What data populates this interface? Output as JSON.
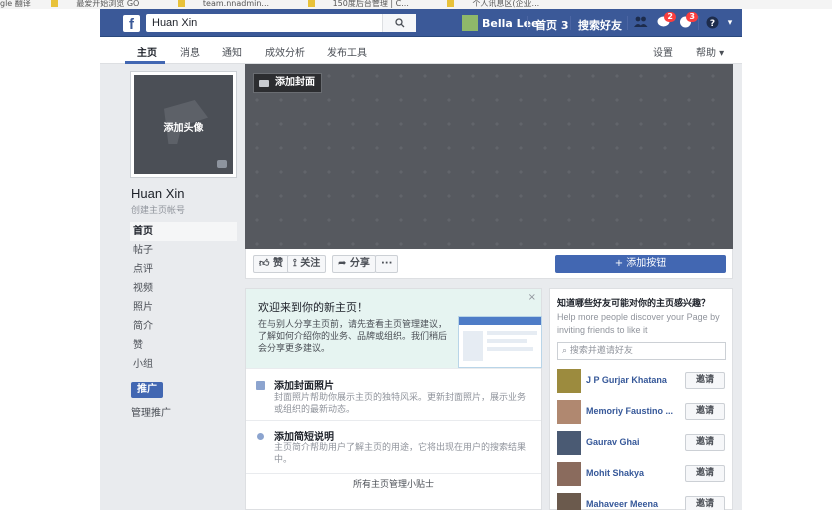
{
  "browser": {
    "bookmarks": [
      "gle 翻译",
      "最爱开始浏览 GO",
      "team.nnadmin...",
      "150度后台管理 | C...",
      "个人讯息区(企业..."
    ]
  },
  "topbar": {
    "logo": "f",
    "search_value": "Huan  Xin",
    "search_icon": "search-icon",
    "user_name": "Bella Lee",
    "home_label": "首页",
    "home_count": "3",
    "find_friends_label": "搜索好友",
    "message_badge": "2",
    "notification_badge": "3",
    "help_icon": "?"
  },
  "tabs": {
    "items": [
      "主页",
      "消息",
      "通知",
      "成效分析",
      "发布工具"
    ],
    "settings": "设置",
    "help": "帮助 ▾"
  },
  "profile": {
    "add_photo": "添加头像",
    "page_name": "Huan Xin",
    "create_username": "创建主页帐号"
  },
  "sidebar": {
    "items": [
      "首页",
      "帖子",
      "点评",
      "视频",
      "照片",
      "简介",
      "赞",
      "小组"
    ],
    "promote_button": "推广",
    "manage_promotions": "管理推广"
  },
  "cover": {
    "add_cover": "添加封面"
  },
  "actions": {
    "like": "赞",
    "follow": "关注",
    "share": "分享",
    "more": "···",
    "add_button": "+ 添加按钮"
  },
  "welcome": {
    "title": "欢迎来到你的新主页！",
    "text": "在与别人分享主页前，请先查看主页管理建议，了解如何介绍你的业务、品牌或组织。我们稍后会分享更多建议。",
    "close": "×",
    "tips": [
      {
        "title": "添加封面照片",
        "text": "封面照片帮助你展示主页的独特风采。更新封面照片，展示业务或组织的最新动态。"
      },
      {
        "title": "添加简短说明",
        "text": "主页简介帮助用户了解主页的用途，它将出现在用户的搜索结果中。"
      }
    ],
    "footer": "所有主页管理小贴士"
  },
  "invite": {
    "title": "知道哪些好友可能对你的主页感兴趣？",
    "subtitle": "Help more people discover your Page by inviting friends to like it",
    "search_placeholder": "搜索并邀请好友",
    "invite_label": "邀请",
    "friends": [
      {
        "name": "J P Gurjar Khatana",
        "color": "#9c8b3e"
      },
      {
        "name": "Memoriy Faustino ...",
        "color": "#b08870"
      },
      {
        "name": "Gaurav Ghai",
        "color": "#4a5a73"
      },
      {
        "name": "Mohit Shakya",
        "color": "#8a6b5d"
      },
      {
        "name": "Mahaveer Meena",
        "color": "#6b5a4d"
      }
    ]
  },
  "colors": {
    "brand_blue": "#3b5998",
    "button_blue": "#4267b2",
    "link_blue": "#365899",
    "page_bg": "#e9ebee"
  }
}
